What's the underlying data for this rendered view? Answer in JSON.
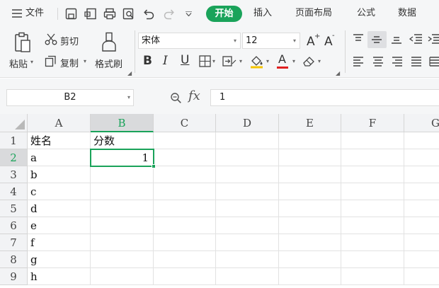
{
  "menubar": {
    "file_label": "文件",
    "tabs": [
      "开始",
      "插入",
      "页面布局",
      "公式",
      "数据"
    ]
  },
  "ribbon": {
    "paste_label": "粘贴",
    "cut_label": "剪切",
    "copy_label": "复制",
    "format_painter_label": "格式刷",
    "font_name": "宋体",
    "font_size": "12",
    "bold_label": "B",
    "italic_label": "I",
    "underline_label": "U",
    "font_color_label": "A",
    "font_color": "#e02020",
    "fill_color": "#f5c400"
  },
  "formula_bar": {
    "cell_reference": "B2",
    "fx_label": "fx",
    "formula_value": "1"
  },
  "sheet": {
    "columns": [
      "A",
      "B",
      "C",
      "D",
      "E",
      "F",
      "G"
    ],
    "rows": [
      "1",
      "2",
      "3",
      "4",
      "5",
      "6",
      "7",
      "8",
      "9"
    ],
    "a_column": [
      "姓名",
      "a",
      "b",
      "c",
      "d",
      "e",
      "f",
      "g",
      "h"
    ],
    "b_column": [
      "分数",
      "1",
      "",
      "",
      "",
      "",
      "",
      "",
      ""
    ],
    "selected_cell": "B2",
    "accent_color": "#1aa35a"
  }
}
